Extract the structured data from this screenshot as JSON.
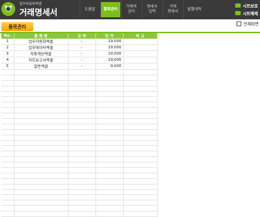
{
  "header": {
    "subtitle": "업무자동화엑셀",
    "title": "거래명세서"
  },
  "nav": [
    {
      "label": "도움말"
    },
    {
      "label": "품목관리"
    },
    {
      "label": "거래처\n관리"
    },
    {
      "label": "명세서\n입력"
    },
    {
      "label": "거래\n명세서"
    },
    {
      "label": "발행내역"
    }
  ],
  "sheet_buttons": {
    "show": "시트보호",
    "unprotect": "시트해제"
  },
  "section_title": "품목관리",
  "fullscreen_label": "전체화면",
  "table": {
    "headers": [
      "No.",
      "품 목 명",
      "규 격",
      "단 가",
      "비 고"
    ],
    "rows": [
      [
        "1",
        "업무자동화엑셀",
        "-",
        "29,000",
        ""
      ],
      [
        "2",
        "업무데이터엑셀",
        "-",
        "29,000",
        ""
      ],
      [
        "3",
        "자동계산엑셀",
        "-",
        "19,000",
        ""
      ],
      [
        "4",
        "자트보고서엑셀",
        "-",
        "19,000",
        ""
      ],
      [
        "5",
        "일반엑셀",
        "-",
        "9,000",
        ""
      ]
    ],
    "empty_rows": 27
  },
  "colors": {
    "accent": "#7cbf1a",
    "header_bg": "#3a3a3a",
    "tab": "#f5a400"
  }
}
